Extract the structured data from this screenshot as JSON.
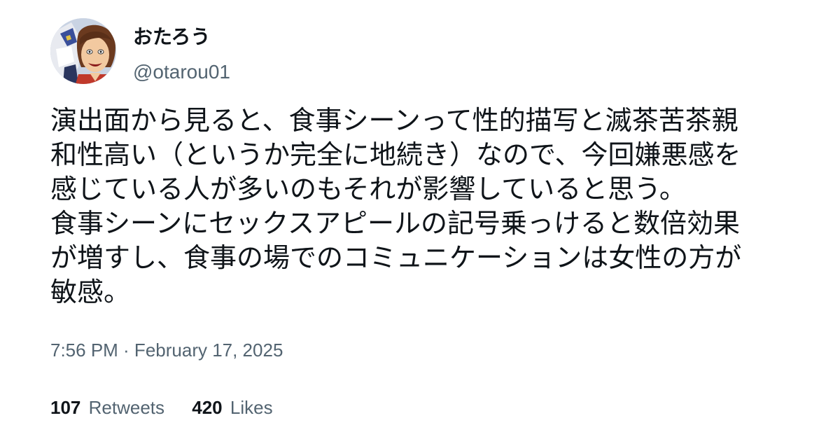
{
  "author": {
    "display_name": "おたろう",
    "handle": "@otarou01"
  },
  "tweet": {
    "lines": [
      "演出面から見ると、食事シーンって性的描写と滅茶苦茶親",
      "和性高い（というか完全に地続き）なので、今回嫌悪感を",
      "感じている人が多いのもそれが影響していると思う。",
      "食事シーンにセックスアピールの記号乗っけると数倍効果",
      "が増すし、食事の場でのコミュニケーションは女性の方が",
      "敏感。"
    ],
    "timestamp": "7:56 PM · February 17, 2025"
  },
  "stats": {
    "retweets_count": "107",
    "retweets_label": "Retweets",
    "likes_count": "420",
    "likes_label": "Likes"
  },
  "colors": {
    "text": "#0f1419",
    "secondary": "#536471",
    "background": "#ffffff"
  }
}
